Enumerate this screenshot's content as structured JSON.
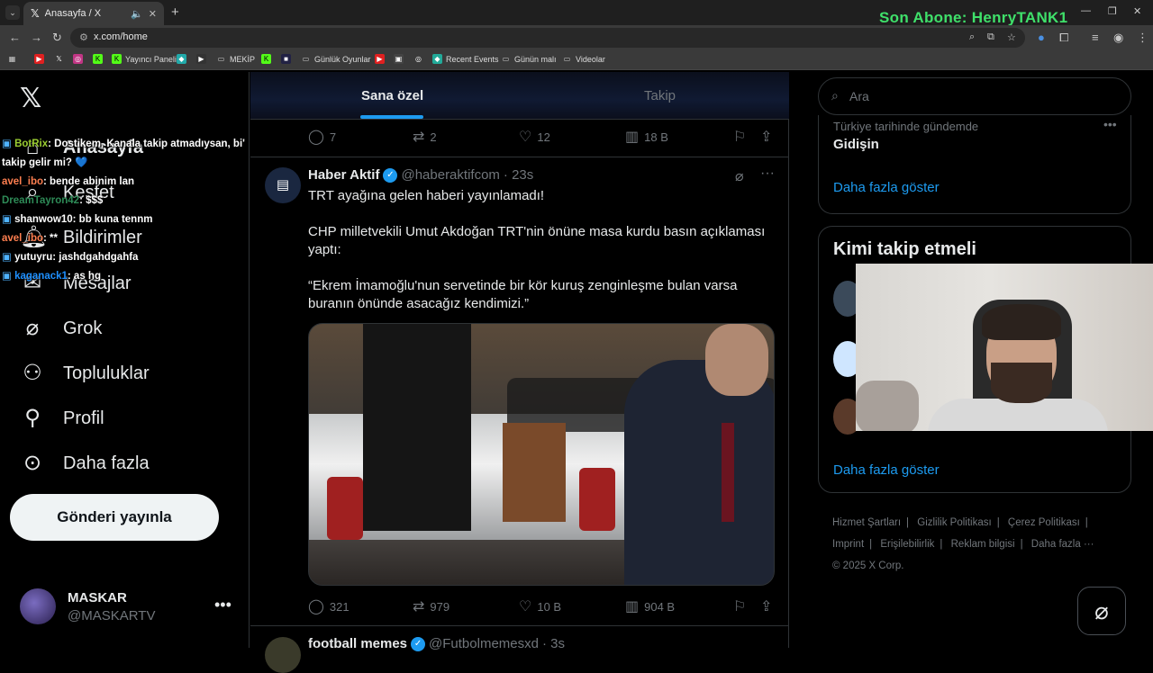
{
  "browser": {
    "tab_title": "Anasayfa / X",
    "url": "x.com/home",
    "bookmarks": [
      "Yayıncı Paneli",
      "MEKİP",
      "Günlük Oyunlar",
      "Recent Events",
      "Günün malı",
      "Videolar"
    ],
    "overlay_text": "Son Abone: HenryTANK1"
  },
  "nav": {
    "items": [
      "Anasayfa",
      "Keşfet",
      "Bildirimler",
      "Mesajlar",
      "Grok",
      "Topluluklar",
      "Profil",
      "Daha fazla"
    ],
    "post_button": "Gönderi yayınla",
    "account_name": "MASKAR",
    "account_handle": "@MASKARTV"
  },
  "chat": [
    {
      "user": "BotRix",
      "text": ": Dostikem, Kanala takip atmadıysan, bi' takip gelir mi? 💙",
      "color": "#9acd32"
    },
    {
      "user": "avel_ibo",
      "text": ": bende abinim lan",
      "color": "#ff7f50"
    },
    {
      "user": "DreamTayron42",
      "text": ": $$$",
      "color": "#2e8b57"
    },
    {
      "user": "shanwow10",
      "text": ": bb kuna tennm",
      "color": "#ffffff"
    },
    {
      "user": "avel_ibo",
      "text": ": **",
      "color": "#ff7f50"
    },
    {
      "user": "yutuyru",
      "text": ": jashdgahdgahfa",
      "color": "#ffffff"
    },
    {
      "user": "kaganack1",
      "text": ": as hg",
      "color": "#1e90ff"
    }
  ],
  "timeline": {
    "tabs": [
      "Sana özel",
      "Takip"
    ],
    "prev_actions": {
      "replies": "7",
      "reposts": "2",
      "likes": "12",
      "views": "18 B"
    },
    "tweet": {
      "name": "Haber Aktif",
      "handle": "@haberaktifcom",
      "time": "· 23s",
      "avatar_icon": "▤",
      "text1": "TRT ayağına gelen haberi yayınlamadı!",
      "text2": "CHP milletvekili Umut Akdoğan TRT'nin önüne masa kurdu basın açıklaması yaptı:",
      "text3": "“Ekrem İmamoğlu'nun servetinde bir kör kuruş zenginleşme bulan varsa buranın önünde asacağız kendimizi.”",
      "replies": "321",
      "reposts": "979",
      "likes": "10 B",
      "views": "904 B"
    },
    "next_tweet": {
      "name": "football memes",
      "handle": "@Futbolmemesxd",
      "time": "· 3s"
    }
  },
  "right": {
    "search_placeholder": "Ara",
    "trend_category": "Türkiye tarihinde gündemde",
    "trend_name": "Gidişin",
    "show_more": "Daha fazla göster",
    "who_to_follow": "Kimi takip etmeli",
    "footer": [
      "Hizmet Şartları",
      "|",
      "Gizlilik Politikası",
      "|",
      "Çerez Politikası",
      "|",
      "Imprint",
      "|",
      "Erişilebilirlik",
      "|",
      "Reklam bilgisi",
      "|",
      "Daha fazla ···",
      "© 2025 X Corp."
    ]
  }
}
